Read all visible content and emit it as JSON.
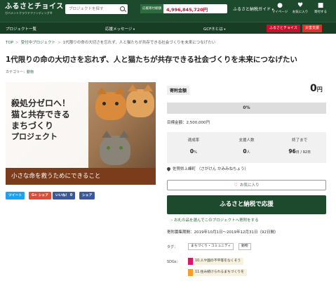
{
  "header": {
    "logo_main": "ふるさとチョイス",
    "logo_sub": "ガバメントクラウドファンディング®",
    "search_placeholder": "プロジェクトを探す",
    "total_label": "応援寄付総額",
    "total_value": "4,996,845,720円",
    "guide_label": "ふるさと納税ガイド",
    "icons": [
      {
        "name": "mypage",
        "glyph": "●",
        "label": "マイページ"
      },
      {
        "name": "favorites",
        "glyph": "♥",
        "label": "お気に入り"
      },
      {
        "name": "donation-list",
        "glyph": "■",
        "label": "寄付する"
      }
    ]
  },
  "nav": {
    "items": [
      "プロジェクト一覧",
      "応援メッセージ",
      "GCFⓇとは"
    ],
    "choice_label": "ふるさとチョイス",
    "gift_label": "災害支援"
  },
  "breadcrumb": {
    "items": [
      "TOP",
      "受付中プロジェクト",
      "1代限りの命の大切さを忘れず、人と猫たちが共存できる社会づくりを未来につなげたい"
    ]
  },
  "project": {
    "title": "1代限りの命の大切さを忘れず、人と猫たちが共存できる社会づくりを未来につなげたい",
    "category_label": "カテゴリー：",
    "category_value": "動物",
    "hero_lines": [
      "殺処分ゼロへ！",
      "猫と共存できる",
      "まちづくり",
      "プロジェクト"
    ],
    "hero_band": "小さな命を救うためにできること"
  },
  "share": {
    "tweet": "ツイート",
    "gplus": "G+ シェア",
    "like": "いいね！ 0",
    "share": "シェア"
  },
  "funding": {
    "label": "寄附金額",
    "amount": "0",
    "unit": "円",
    "progress_percent": 0,
    "progress_text": "0%",
    "goal": "目標金額：2,500,000円",
    "stats": [
      {
        "label": "達成率",
        "value": "0",
        "unit": "%"
      },
      {
        "label": "支援人数",
        "value": "0",
        "unit": "人"
      },
      {
        "label": "終了まで",
        "value": "96",
        "unit": "日 / 92日"
      }
    ],
    "location": "佐賀県上峰町 （さがけん かみみねちょう）",
    "favorite_label": "お気に入り",
    "donate_label": "ふるさと納税で応援",
    "gift_link": "お礼の品を選んでこのプロジェクトへ寄附をする",
    "period": "寄附募集期間：2019年10月1日～2019年12月31日（92日間）",
    "tags_label": "タグ：",
    "tags": [
      "まちづくり・コミュニティ",
      "動物"
    ],
    "sdgs_label": "SDGs：",
    "sdgs": [
      {
        "text": "10.人や国の不平等をなくそう",
        "color": "#dd1367"
      },
      {
        "text": "11.住み続けられるまちづくりを",
        "color": "#f99d26"
      }
    ]
  }
}
